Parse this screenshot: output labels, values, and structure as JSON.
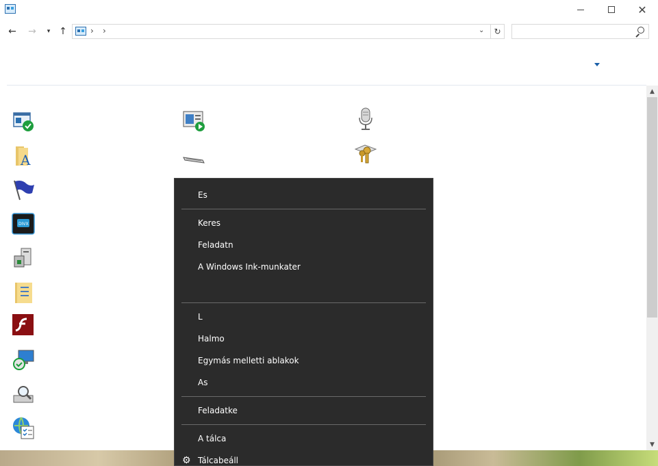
{
  "window": {
    "controls": {
      "minimize": "",
      "maximize": "",
      "close": "✕"
    }
  },
  "address_bar": {
    "sep1": "›",
    "sep2": "›",
    "dropdown": "⌄",
    "refresh": "↻"
  },
  "search": {
    "placeholder": ""
  },
  "icons": [
    "security-center-icon",
    "autoplay-icon",
    "microphone-icon",
    "fonts-folder-icon",
    "keyboard-icon",
    "credential-manager-icon",
    "flag-icon",
    "divx-icon",
    "device-manager-icon",
    "folder-options-icon",
    "flash-player-icon",
    "remote-desktop-icon",
    "indexing-icon",
    "internet-options-icon"
  ],
  "context_menu": {
    "items": [
      {
        "label": "Es"
      },
      {
        "label": "Keres"
      },
      {
        "label": "Feladatn"
      },
      {
        "label": "A Windows Ink-munkater"
      },
      {
        "label": "L"
      },
      {
        "label": "Halmo"
      },
      {
        "label": "Egymás melletti ablakok"
      },
      {
        "label": "As"
      },
      {
        "label": "Feladatke"
      },
      {
        "label": "A tálca"
      },
      {
        "label": "Tálcabeáll"
      }
    ]
  },
  "colors": {
    "menu_bg": "#2b2b2b",
    "menu_text": "#ffffff",
    "accent": "#1a5fa8"
  }
}
